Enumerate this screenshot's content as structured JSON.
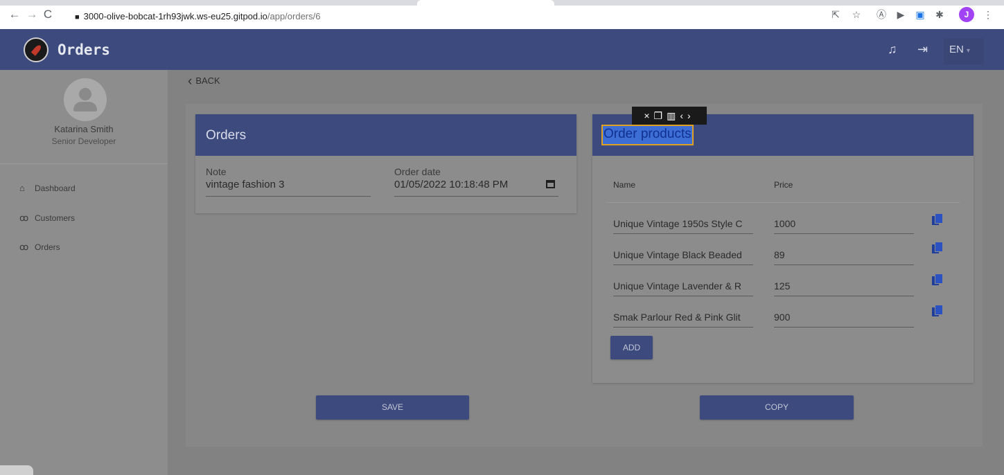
{
  "browser": {
    "url_host": "3000-olive-bobcat-1rh93jwk.ws-eu25.gitpod.io",
    "url_path": "/app/orders/6",
    "profile_initial": "J"
  },
  "header": {
    "title": "Orders",
    "language": "EN"
  },
  "user": {
    "name": "Katarina Smith",
    "role": "Senior Developer"
  },
  "sidebar": {
    "items": [
      {
        "label": "Dashboard",
        "icon": "home-icon"
      },
      {
        "label": "Customers",
        "icon": "users-icon"
      },
      {
        "label": "Orders",
        "icon": "users-icon"
      }
    ]
  },
  "main": {
    "back_label": "BACK",
    "orders_card": {
      "title": "Orders",
      "note_label": "Note",
      "note_value": "vintage fashion 3",
      "date_label": "Order date",
      "date_value": "01/05/2022 10:18:48 PM"
    },
    "products_card": {
      "title": "Order products",
      "columns": {
        "name": "Name",
        "price": "Price"
      },
      "rows": [
        {
          "name": "Unique Vintage 1950s Style C",
          "price": "1000"
        },
        {
          "name": "Unique Vintage Black Beaded",
          "price": "89"
        },
        {
          "name": "Unique Vintage Lavender & R",
          "price": "125"
        },
        {
          "name": "Smak Parlour Red & Pink Glit",
          "price": "900"
        }
      ],
      "add_label": "ADD"
    },
    "save_label": "SAVE",
    "copy_label": "COPY"
  },
  "colors": {
    "primary": "#3d4a7d",
    "highlight": "#3d6ed6",
    "selection_outline": "#e0a020"
  }
}
